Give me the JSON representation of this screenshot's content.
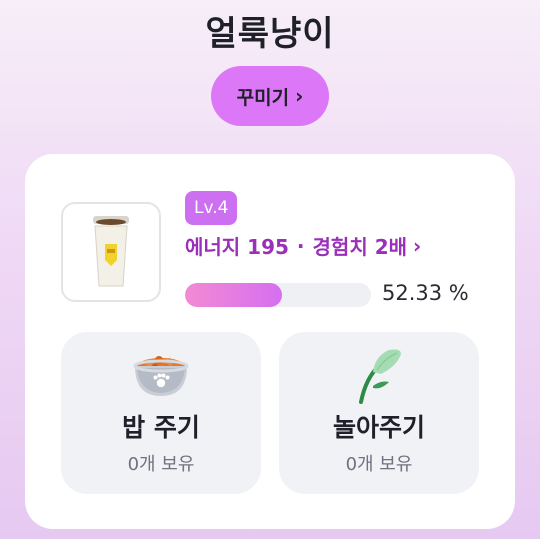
{
  "header": {
    "title": "얼룩냥이"
  },
  "decorate_button": {
    "label": "꾸미기",
    "chevron": "›"
  },
  "item": {
    "icon": "coffee-cup-icon"
  },
  "level": {
    "label": "Lv.4"
  },
  "stats": {
    "energy_label": "에너지 195",
    "separator": "·",
    "exp_label": "경험치 2배",
    "chevron": "›"
  },
  "progress": {
    "percent": 52.33,
    "text": "52.33 %"
  },
  "actions": [
    {
      "icon": "food-bowl-icon",
      "label": "밥 주기",
      "owned": "0개 보유"
    },
    {
      "icon": "cat-toy-icon",
      "label": "놀아주기",
      "owned": "0개 보유"
    }
  ],
  "colors": {
    "accent": "#dc78f7",
    "level_badge": "#cc6ff0",
    "stat_text": "#9b2fb9",
    "progress_start": "#f28ad3",
    "progress_end": "#d56ff0"
  }
}
